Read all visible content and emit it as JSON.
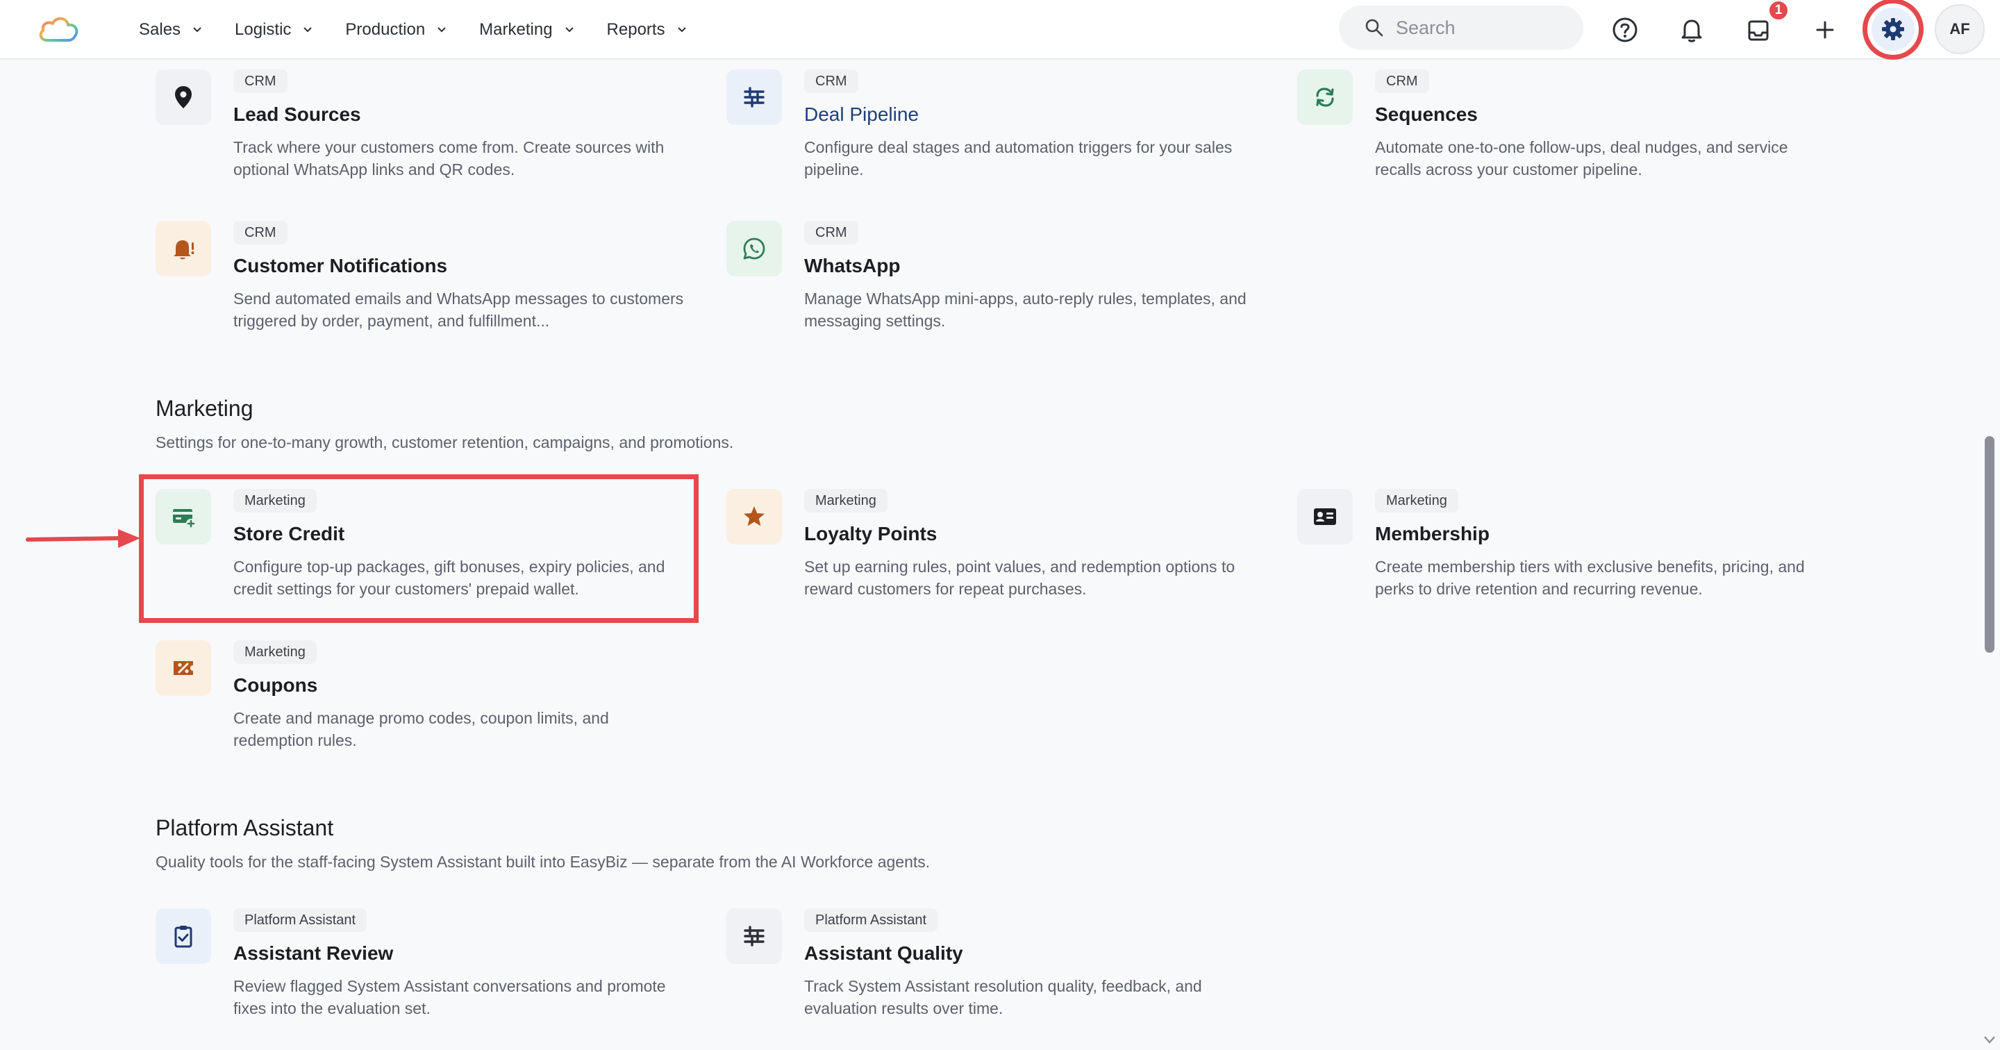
{
  "app": {
    "logo_icon": "cloud-logo-icon"
  },
  "nav": {
    "items": [
      {
        "label": "Sales"
      },
      {
        "label": "Logistic"
      },
      {
        "label": "Production"
      },
      {
        "label": "Marketing"
      },
      {
        "label": "Reports"
      }
    ]
  },
  "toolbar": {
    "search_placeholder": "Search",
    "inbox_badge": "1",
    "avatar_initials": "AF",
    "icons": [
      "search-icon",
      "help-icon",
      "bell-icon",
      "inbox-icon",
      "plus-icon",
      "gear-icon"
    ]
  },
  "crm_cards": [
    {
      "tag": "CRM",
      "title": "Lead Sources",
      "desc": "Track where your customers come from. Create sources with optional WhatsApp links and QR codes.",
      "icon": "map-pin-icon"
    },
    {
      "tag": "CRM",
      "title": "Deal Pipeline",
      "desc": "Configure deal stages and automation triggers for your sales pipeline.",
      "icon": "pipeline-icon"
    },
    {
      "tag": "CRM",
      "title": "Sequences",
      "desc": "Automate one-to-one follow-ups, deal nudges, and service recalls across your customer pipeline.",
      "icon": "refresh-icon"
    },
    {
      "tag": "CRM",
      "title": "Customer Notifications",
      "desc": "Send automated emails and WhatsApp messages to customers triggered by order, payment, and fulfillment...",
      "icon": "bell-alert-icon"
    },
    {
      "tag": "CRM",
      "title": "WhatsApp",
      "desc": "Manage WhatsApp mini-apps, auto-reply rules, templates, and messaging settings.",
      "icon": "whatsapp-icon"
    }
  ],
  "marketing": {
    "title": "Marketing",
    "desc": "Settings for one-to-many growth, customer retention, campaigns, and promotions.",
    "cards": [
      {
        "tag": "Marketing",
        "title": "Store Credit",
        "desc": "Configure top-up packages, gift bonuses, expiry policies, and credit settings for your customers' prepaid wallet.",
        "icon": "wallet-plus-icon"
      },
      {
        "tag": "Marketing",
        "title": "Loyalty Points",
        "desc": "Set up earning rules, point values, and redemption options to reward customers for repeat purchases.",
        "icon": "star-icon"
      },
      {
        "tag": "Marketing",
        "title": "Membership",
        "desc": "Create membership tiers with exclusive benefits, pricing, and perks to drive retention and recurring revenue.",
        "icon": "id-card-icon"
      },
      {
        "tag": "Marketing",
        "title": "Coupons",
        "desc": "Create and manage promo codes, coupon limits, and redemption rules.",
        "icon": "coupon-icon"
      }
    ]
  },
  "platform_assistant": {
    "title": "Platform Assistant",
    "desc": "Quality tools for the staff-facing System Assistant built into EasyBiz — separate from the AI Workforce agents.",
    "cards": [
      {
        "tag": "Platform Assistant",
        "title": "Assistant Review",
        "desc": "Review flagged System Assistant conversations and promote fixes into the evaluation set.",
        "icon": "clipboard-check-icon"
      },
      {
        "tag": "Platform Assistant",
        "title": "Assistant Quality",
        "desc": "Track System Assistant resolution quality, feedback, and evaluation results over time.",
        "icon": "sliders-icon"
      }
    ]
  },
  "colors": {
    "accent_red": "#e5484d",
    "link_blue": "#1f3f7a",
    "green_icon": "#2f7d57",
    "orange_icon": "#b4561c"
  }
}
